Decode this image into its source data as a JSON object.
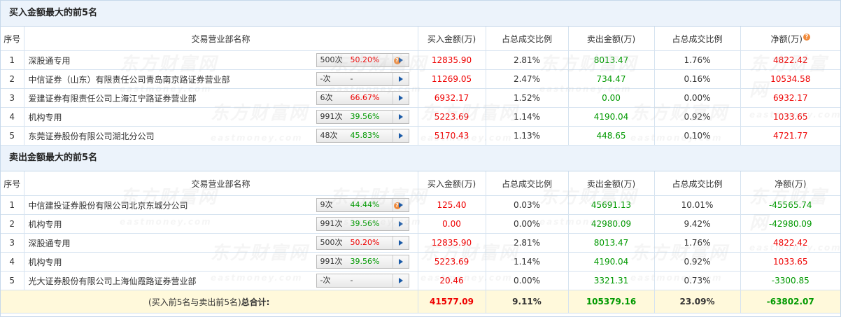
{
  "buy_section": {
    "title": "买入金额最大的前5名",
    "headers": {
      "rank": "序号",
      "branch": "交易营业部名称",
      "buy": "买入金额(万)",
      "buy_ratio": "占总成交比例",
      "sell": "卖出金额(万)",
      "sell_ratio": "占总成交比例",
      "net": "净额(万)"
    },
    "rows": [
      {
        "rank": "1",
        "name": "深股通专用",
        "count": "500次",
        "pct": "50.20%",
        "pct_color": "red",
        "help": "?",
        "buy": "12835.90",
        "buy_ratio": "2.81%",
        "sell": "8013.47",
        "sell_ratio": "1.76%",
        "net": "4822.42",
        "net_color": "red"
      },
      {
        "rank": "2",
        "name": "中信证券（山东）有限责任公司青岛南京路证券营业部",
        "count": "-次",
        "pct": "-",
        "pct_color": "dark",
        "help": "",
        "buy": "11269.05",
        "buy_ratio": "2.47%",
        "sell": "734.47",
        "sell_ratio": "0.16%",
        "net": "10534.58",
        "net_color": "red"
      },
      {
        "rank": "3",
        "name": "爱建证券有限责任公司上海江宁路证券营业部",
        "count": "6次",
        "pct": "66.67%",
        "pct_color": "red",
        "help": "",
        "buy": "6932.17",
        "buy_ratio": "1.52%",
        "sell": "0.00",
        "sell_ratio": "0.00%",
        "net": "6932.17",
        "net_color": "red"
      },
      {
        "rank": "4",
        "name": "机构专用",
        "count": "991次",
        "pct": "39.56%",
        "pct_color": "green",
        "help": "",
        "buy": "5223.69",
        "buy_ratio": "1.14%",
        "sell": "4190.04",
        "sell_ratio": "0.92%",
        "net": "1033.65",
        "net_color": "red"
      },
      {
        "rank": "5",
        "name": "东莞证券股份有限公司湖北分公司",
        "count": "48次",
        "pct": "45.83%",
        "pct_color": "green",
        "help": "",
        "buy": "5170.43",
        "buy_ratio": "1.13%",
        "sell": "448.65",
        "sell_ratio": "0.10%",
        "net": "4721.77",
        "net_color": "red"
      }
    ]
  },
  "sell_section": {
    "title": "卖出金额最大的前5名",
    "headers": {
      "rank": "序号",
      "branch": "交易营业部名称",
      "buy": "买入金额(万)",
      "buy_ratio": "占总成交比例",
      "sell": "卖出金额(万)",
      "sell_ratio": "占总成交比例",
      "net": "净额(万)"
    },
    "rows": [
      {
        "rank": "1",
        "name": "中信建投证券股份有限公司北京东城分公司",
        "count": "9次",
        "pct": "44.44%",
        "pct_color": "green",
        "help": "?",
        "buy": "125.40",
        "buy_ratio": "0.03%",
        "sell": "45691.13",
        "sell_ratio": "10.01%",
        "net": "-45565.74",
        "net_color": "green"
      },
      {
        "rank": "2",
        "name": "机构专用",
        "count": "991次",
        "pct": "39.56%",
        "pct_color": "green",
        "help": "",
        "buy": "0.00",
        "buy_ratio": "0.00%",
        "sell": "42980.09",
        "sell_ratio": "9.42%",
        "net": "-42980.09",
        "net_color": "green"
      },
      {
        "rank": "3",
        "name": "深股通专用",
        "count": "500次",
        "pct": "50.20%",
        "pct_color": "red",
        "help": "",
        "buy": "12835.90",
        "buy_ratio": "2.81%",
        "sell": "8013.47",
        "sell_ratio": "1.76%",
        "net": "4822.42",
        "net_color": "red"
      },
      {
        "rank": "4",
        "name": "机构专用",
        "count": "991次",
        "pct": "39.56%",
        "pct_color": "green",
        "help": "",
        "buy": "5223.69",
        "buy_ratio": "1.14%",
        "sell": "4190.04",
        "sell_ratio": "0.92%",
        "net": "1033.65",
        "net_color": "red"
      },
      {
        "rank": "5",
        "name": "光大证券股份有限公司上海仙霞路证券营业部",
        "count": "-次",
        "pct": "-",
        "pct_color": "dark",
        "help": "",
        "buy": "20.46",
        "buy_ratio": "0.00%",
        "sell": "3321.31",
        "sell_ratio": "0.73%",
        "net": "-3300.85",
        "net_color": "green"
      }
    ]
  },
  "total": {
    "label_prefix": "(买入前5名与卖出前5名)",
    "label_bold": "总合计:",
    "buy": "41577.09",
    "buy_ratio": "9.11%",
    "sell": "105379.16",
    "sell_ratio": "23.09%",
    "net": "-63802.07"
  },
  "net_help_icon": "?",
  "watermark": {
    "cn": "东方财富网",
    "en": "eastmoney.com"
  },
  "colors": {
    "red": "#ee0000",
    "green": "#009900",
    "dark": "#333333",
    "accent": "#1a5aa7",
    "header_bg": "#ecf3fb",
    "total_bg": "#fff9db"
  }
}
